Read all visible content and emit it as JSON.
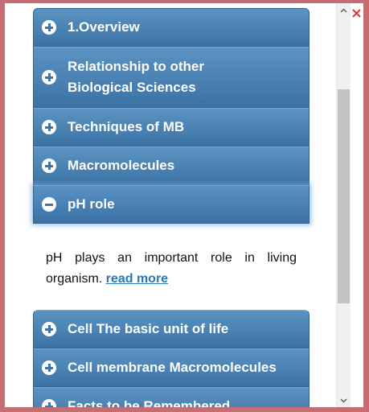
{
  "accordion": {
    "items": [
      {
        "label": "1.Overview",
        "expanded": false
      },
      {
        "label": "Relationship to other\nBiological Sciences",
        "expanded": false
      },
      {
        "label": "Techniques of MB",
        "expanded": false
      },
      {
        "label": "Macromolecules",
        "expanded": false
      },
      {
        "label": "pH role",
        "expanded": true
      },
      {
        "label": "Cell The basic unit of life",
        "expanded": false
      },
      {
        "label": "Cell membrane Macromolecules",
        "expanded": false
      },
      {
        "label": "Facts to be Remembered",
        "expanded": false
      }
    ],
    "panel": {
      "text": "pH plays an important role in living organism.",
      "link": "read more"
    }
  },
  "icons": {
    "expand": "plus-circle-icon",
    "collapse": "minus-circle-icon",
    "close": "close-icon",
    "scroll_up": "chevron-up-icon",
    "scroll_down": "chevron-down-icon"
  },
  "colors": {
    "header_top": "#5b93c2",
    "header_bottom": "#3c73a6",
    "link": "#2a78b7",
    "close": "#d53a3a",
    "window_border": "#c46d73"
  }
}
